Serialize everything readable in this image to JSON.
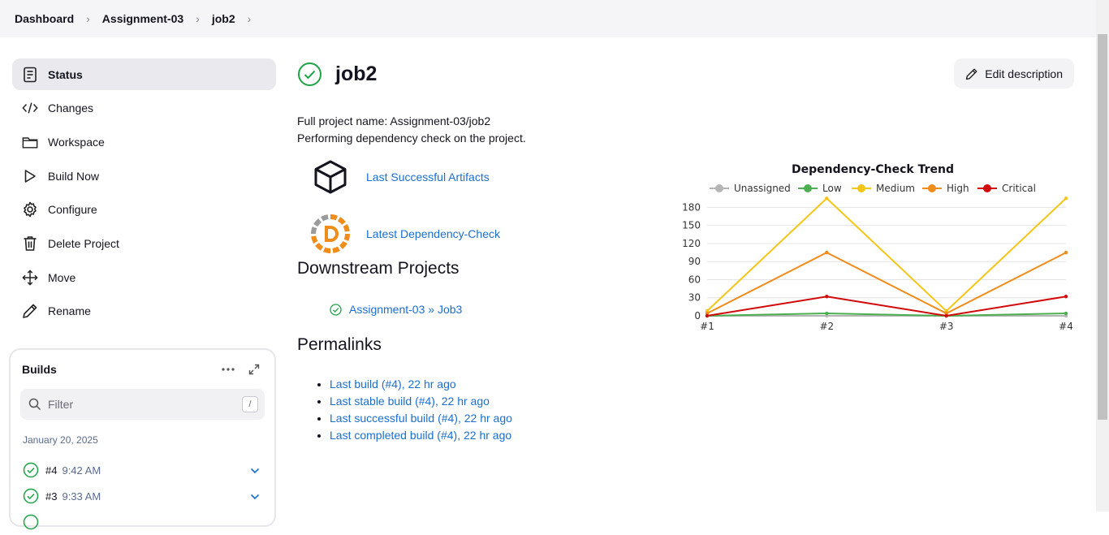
{
  "breadcrumb": [
    "Dashboard",
    "Assignment-03",
    "job2"
  ],
  "sidebar": {
    "items": [
      {
        "label": "Status",
        "icon": "status-icon"
      },
      {
        "label": "Changes",
        "icon": "code-icon"
      },
      {
        "label": "Workspace",
        "icon": "folder-icon"
      },
      {
        "label": "Build Now",
        "icon": "play-icon"
      },
      {
        "label": "Configure",
        "icon": "gear-icon"
      },
      {
        "label": "Delete Project",
        "icon": "trash-icon"
      },
      {
        "label": "Move",
        "icon": "move-icon"
      },
      {
        "label": "Rename",
        "icon": "pencil-icon"
      }
    ]
  },
  "builds": {
    "title": "Builds",
    "filter_placeholder": "Filter",
    "filter_shortcut": "/",
    "date": "January 20, 2025",
    "rows": [
      {
        "num": "#4",
        "time": "9:42 AM"
      },
      {
        "num": "#3",
        "time": "9:33 AM"
      }
    ]
  },
  "main": {
    "title": "job2",
    "edit_label": "Edit description",
    "full_name": "Full project name: Assignment-03/job2",
    "description": "Performing dependency check on the project.",
    "artifacts_link": "Last Successful Artifacts",
    "depcheck_link": "Latest Dependency-Check",
    "downstream_heading": "Downstream Projects",
    "downstream_link": "Assignment-03 » Job3",
    "permalinks_heading": "Permalinks",
    "permalinks": [
      "Last build (#4), 22 hr ago",
      "Last stable build (#4), 22 hr ago",
      "Last successful build (#4), 22 hr ago",
      "Last completed build (#4), 22 hr ago"
    ]
  },
  "colors": {
    "success": "#1ea446",
    "link": "#1a6fd1",
    "unassigned": "#b5b5b5",
    "low": "#4caf50",
    "medium": "#f5c518",
    "high": "#f08c1a",
    "critical": "#d10a0a"
  },
  "chart_data": {
    "type": "line",
    "title": "Dependency-Check Trend",
    "categories": [
      "#1",
      "#2",
      "#3",
      "#4"
    ],
    "ylim": [
      0,
      190
    ],
    "yticks": [
      0,
      30,
      60,
      90,
      120,
      150,
      180
    ],
    "grid": true,
    "legend": "top",
    "series": [
      {
        "name": "Unassigned",
        "color": "#b5b5b5",
        "values": [
          0,
          0,
          0,
          0
        ]
      },
      {
        "name": "Low",
        "color": "#4caf50",
        "values": [
          0,
          4,
          0,
          4
        ]
      },
      {
        "name": "Medium",
        "color": "#f5c518",
        "values": [
          8,
          195,
          8,
          195
        ]
      },
      {
        "name": "High",
        "color": "#f08c1a",
        "values": [
          4,
          105,
          4,
          105
        ]
      },
      {
        "name": "Critical",
        "color": "#d10a0a",
        "values": [
          0,
          32,
          0,
          32
        ]
      }
    ]
  }
}
